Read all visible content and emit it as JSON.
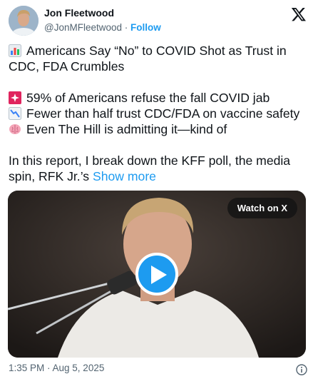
{
  "author": {
    "name": "Jon Fleetwood",
    "handle": "@JonMFleetwood",
    "separator": "·",
    "follow_label": "Follow"
  },
  "tweet": {
    "title_line1": "Americans Say “No” to COVID Shot as Trust in",
    "title_line2": "CDC, FDA Crumbles",
    "bullet1": "59% of Americans refuse the fall COVID jab",
    "bullet2": "Fewer than half trust CDC/FDA on vaccine safety",
    "bullet3": "Even The Hill is admitting it—kind of",
    "body_line1": "In this report, I break down the KFF poll, the media",
    "body_line2": "spin, RFK Jr.’s",
    "show_more": "Show more"
  },
  "icons": {
    "title": "bar-chart-icon",
    "bullet1": "siren-icon",
    "bullet2": "chart-decreasing-icon",
    "bullet3": "brain-icon"
  },
  "video": {
    "watch_label": "Watch on X"
  },
  "footer": {
    "timestamp": "1:35 PM · Aug 5, 2025"
  },
  "colors": {
    "accent": "#1d9bf0",
    "text": "#0f1419",
    "muted": "#536471"
  }
}
